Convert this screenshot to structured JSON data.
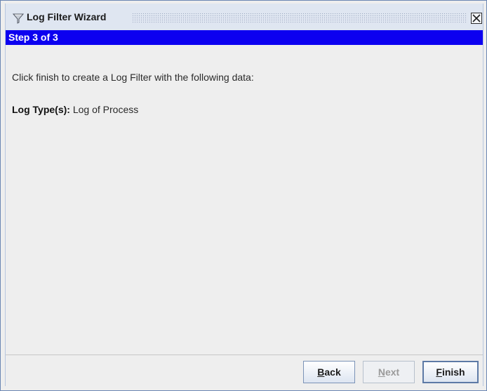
{
  "window": {
    "title": "Log Filter Wizard",
    "icon": "funnel-icon",
    "close_icon": "close-icon"
  },
  "step": {
    "label": "Step 3 of 3",
    "banner_color": "#0c00f0"
  },
  "content": {
    "intro": "Click finish to create a Log Filter with the following data:",
    "log_type_label": "Log Type(s):",
    "log_type_value": " Log of Process"
  },
  "buttons": {
    "back": {
      "first": "B",
      "rest": "ack"
    },
    "next": {
      "first": "N",
      "rest": "ext"
    },
    "finish": {
      "first": "F",
      "rest": "inish"
    }
  }
}
